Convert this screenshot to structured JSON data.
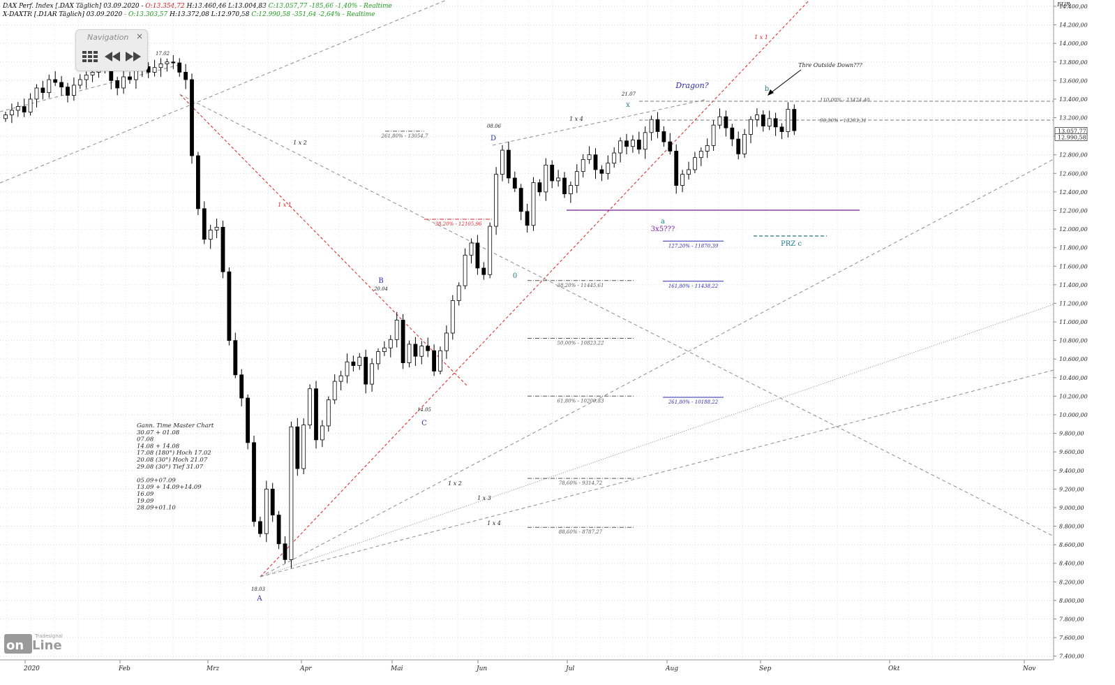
{
  "header": {
    "line1": {
      "prefix": "DAX Perf. Index [.DAX Täglich] 03.09.2020 - ",
      "open": "O:13.354,72",
      "hl": " H:13.460,46 L:13.004,83 ",
      "change": "C:13.057,77 -185,66 -1,40% - Realtime"
    },
    "line2": {
      "prefix": "X-DAXTR [.D1AR Täglich] 03.09.2020 - ",
      "open": "O:13.303,57",
      "hl": " H:13.372,08 L:12.970,58 ",
      "change": "C:12.990,58 -351,64 -2,64% - Realtime"
    }
  },
  "navigation": {
    "title": "Navigation",
    "close": "×",
    "icons": [
      "grid-icon",
      "rewind-icon",
      "fast-forward-icon"
    ]
  },
  "logo": {
    "top": "Tradesignal",
    "main": "online"
  },
  "colors": {
    "up": "#ffffff",
    "down": "#000000",
    "red_dash": "#e02020",
    "grey_dash": "#8c8c8c",
    "purple": "#7a1fa0",
    "teal": "#1f7a85",
    "blue": "#2b2bb0",
    "header_red": "#d01010",
    "header_green": "#1a9a1a"
  },
  "chart_data": {
    "type": "candlestick",
    "currency": "EUR",
    "x_labels": [
      "2020",
      "Feb",
      "Mrz",
      "Apr",
      "Mai",
      "Jun",
      "Jul",
      "Aug",
      "Sep",
      "Okt",
      "Nov"
    ],
    "y_ticks": [
      7400,
      7600,
      7800,
      8000,
      8200,
      8400,
      8600,
      8800,
      9000,
      9200,
      9400,
      9600,
      9800,
      10000,
      10200,
      10400,
      10600,
      10800,
      11000,
      11200,
      11400,
      11600,
      11800,
      12000,
      12200,
      12400,
      12600,
      12800,
      13000,
      13200,
      13400,
      13600,
      13800,
      14000,
      14200,
      14400
    ],
    "y_tick_labels": [
      "7.400,00",
      "7.600,00",
      "7.800,00",
      "8.000,00",
      "8.200,00",
      "8.400,00",
      "8.600,00",
      "8.800,00",
      "9.000,00",
      "9.200,00",
      "9.400,00",
      "9.600,00",
      "9.800,00",
      "10.000,00",
      "10.200,00",
      "10.400,00",
      "10.600,00",
      "10.800,00",
      "11.000,00",
      "11.200,00",
      "11.400,00",
      "11.600,00",
      "11.800,00",
      "12.000,00",
      "12.200,00",
      "12.400,00",
      "12.600,00",
      "12.800,00",
      "13.000,00",
      "13.200,00",
      "13.400,00",
      "13.600,00",
      "13.800,00",
      "14.000,00",
      "14.200,00",
      "14.400,00"
    ],
    "ylim": [
      7360,
      14460
    ],
    "last_price_labels": [
      "13.057,77",
      "12.990,58"
    ],
    "closes": [
      13230,
      13280,
      13320,
      13260,
      13400,
      13520,
      13470,
      13610,
      13580,
      13530,
      13440,
      13550,
      13610,
      13660,
      13690,
      13720,
      13780,
      13600,
      13520,
      13640,
      13610,
      13720,
      13750,
      13690,
      13740,
      13780,
      13800,
      13790,
      13690,
      13610,
      12790,
      12220,
      11890,
      11990,
      12020,
      11540,
      10800,
      10430,
      10180,
      9700,
      8850,
      8720,
      9200,
      8920,
      8610,
      8440,
      9870,
      9420,
      9890,
      10280,
      9730,
      9880,
      10160,
      10360,
      10420,
      10570,
      10530,
      10620,
      10330,
      10550,
      10680,
      10720,
      10810,
      11020,
      10560,
      10760,
      10630,
      10740,
      10690,
      10470,
      10690,
      10880,
      11230,
      11390,
      11720,
      11850,
      11580,
      11510,
      12030,
      12590,
      12850,
      12550,
      12440,
      12190,
      12040,
      12500,
      12400,
      12690,
      12520,
      12550,
      12380,
      12470,
      12620,
      12750,
      12800,
      12640,
      12600,
      12710,
      12820,
      12950,
      12890,
      12960,
      12860,
      13040,
      13180,
      13050,
      12940,
      12840,
      12470,
      12590,
      12640,
      12770,
      12840,
      12900,
      13120,
      13210,
      13090,
      12970,
      12810,
      13020,
      13180,
      13230,
      13110,
      13190,
      13100,
      13050,
      13290,
      13060
    ],
    "points": [
      {
        "label": "A",
        "date": "18.03",
        "value": 8255
      },
      {
        "label": "B",
        "date": "20.04",
        "value": 11230
      },
      {
        "label": "C",
        "date": "14.05",
        "value": 10160
      },
      {
        "label": "D",
        "date": "08.06",
        "value": 12950
      },
      {
        "label": "0",
        "date": "",
        "value": 11510
      },
      {
        "label": "x",
        "date": "21.07",
        "value": 13310
      },
      {
        "label": "a",
        "date": "",
        "value": 12250
      },
      {
        "label": "b",
        "date": "",
        "value": 13460
      }
    ],
    "fib_levels": [
      {
        "label": "261,80% - 13054,7",
        "value": 13054.7
      },
      {
        "label": "38,20% - 12105,96",
        "value": 12105.96
      },
      {
        "label": "38,20% - 11445,61",
        "value": 11445.61
      },
      {
        "label": "50,00% - 10823,22",
        "value": 10823.22
      },
      {
        "label": "61,80% - 10200,83",
        "value": 10200.83
      },
      {
        "label": "78,60% - 9314,72",
        "value": 9314.72
      },
      {
        "label": "88,60% - 8787,27",
        "value": 8787.27
      },
      {
        "label": "127,20% - 11870,39",
        "value": 11870.39
      },
      {
        "label": "161,80% - 11438,22",
        "value": 11438.22
      },
      {
        "label": "261,80% - 10188,22",
        "value": 10188.22
      },
      {
        "label": "110,00% - 13424,40",
        "value": 13424.4
      },
      {
        "label": "90,00% - 13203,31",
        "value": 13203.31
      }
    ],
    "annotations": {
      "dragon": "Dragon?",
      "outside": "Thre Outside Down???",
      "three_x": "3x5???",
      "prz": "PRZ c",
      "gann_labels": [
        "1 x 1",
        "1 x 2",
        "1 x 2",
        "1 x 3",
        "1 x 4",
        "1 x 4",
        "1 x 1",
        "1 x 1"
      ],
      "high_label": "17.02",
      "gann_notes": [
        "Gann. Time Master Chart",
        "30.07 + 01.08",
        "07.08",
        "14.08 + 14.08",
        "17.08 (180°) Hoch 17.02",
        "20.08 (30°) Hoch 21.07",
        "29.08 (30°) Tief 31.07",
        "",
        "05.09+07.09",
        "13.09 + 14.09+14.09",
        "16.09",
        "19.09",
        "28.09+01.10"
      ]
    }
  }
}
